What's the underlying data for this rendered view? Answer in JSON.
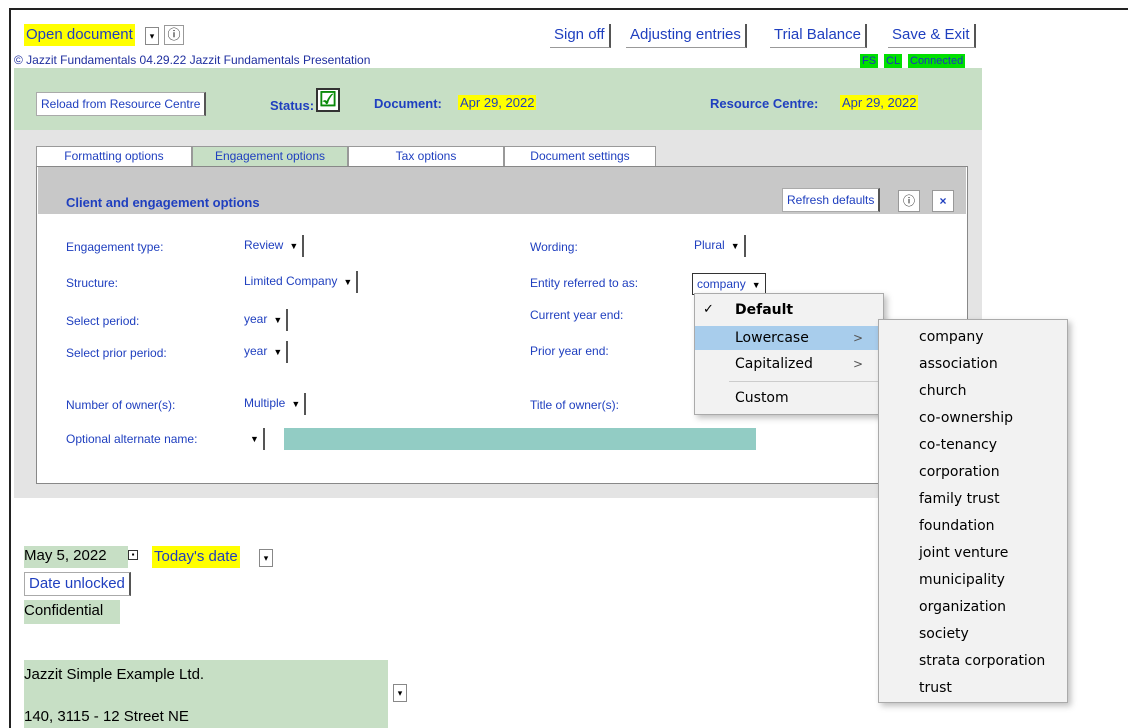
{
  "top": {
    "open_document": "Open document",
    "info_symbol": "ⓘ",
    "sign_off": "Sign off",
    "adjusting_entries": "Adjusting entries",
    "trial_balance": "Trial Balance",
    "save_exit": "Save & Exit",
    "copyright": "© Jazzit Fundamentals 04.29.22 Jazzit Fundamentals Presentation",
    "badges": [
      "FS",
      "CL",
      "Connected"
    ]
  },
  "status_bar": {
    "reload": "Reload from Resource Centre",
    "status_label": "Status:",
    "status_check": "☑",
    "document_label": "Document:",
    "document_date": "Apr 29, 2022",
    "resource_label": "Resource Centre:",
    "resource_date": "Apr 29, 2022"
  },
  "tabs": [
    {
      "label": "Formatting options"
    },
    {
      "label": "Engagement options"
    },
    {
      "label": "Tax options"
    },
    {
      "label": "Document settings"
    }
  ],
  "panel": {
    "title": "Client and engagement options",
    "refresh": "Refresh defaults",
    "info": "ⓘ",
    "close": "×"
  },
  "form": {
    "engagement_type": {
      "label": "Engagement type:",
      "value": "Review"
    },
    "structure": {
      "label": "Structure:",
      "value": "Limited Company"
    },
    "select_period": {
      "label": "Select period:",
      "value": "year"
    },
    "select_prior_period": {
      "label": "Select prior period:",
      "value": "year"
    },
    "number_of_owners": {
      "label": "Number of owner(s):",
      "value": "Multiple"
    },
    "optional_alternate_name": {
      "label": "Optional alternate name:",
      "value": ""
    },
    "wording": {
      "label": "Wording:",
      "value": "Plural"
    },
    "entity_referred": {
      "label": "Entity referred to as:",
      "value": "company"
    },
    "current_year_end": {
      "label": "Current year end:"
    },
    "prior_year_end": {
      "label": "Prior year end:"
    },
    "title_of_owners": {
      "label": "Title of owner(s):"
    }
  },
  "menu": {
    "items": [
      {
        "label": "Default",
        "checked": true
      },
      {
        "label": "Lowercase",
        "highlighted": true
      },
      {
        "label": "Capitalized"
      },
      {
        "label": "Custom"
      }
    ]
  },
  "submenu": {
    "items": [
      "company",
      "association",
      "church",
      "co-ownership",
      "co-tenancy",
      "corporation",
      "family trust",
      "foundation",
      "joint venture",
      "municipality",
      "organization",
      "society",
      "strata corporation",
      "trust"
    ]
  },
  "document": {
    "date": "May 5, 2022",
    "todays_date": "Today's date",
    "date_unlocked": "Date unlocked",
    "confidential": "Confidential",
    "company_name": "Jazzit Simple Example Ltd.",
    "address": "140, 3115 - 12 Street NE"
  }
}
